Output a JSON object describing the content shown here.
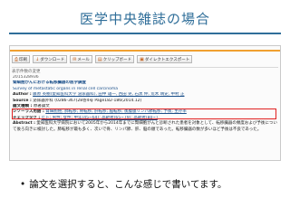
{
  "slide": {
    "title": "医学中央雑誌の場合",
    "bullet": "論文を選択すると、こんな感じで書いてます。"
  },
  "toolbar": {
    "buttons": [
      {
        "icon": "printer-icon",
        "glyph": "⎙",
        "label": "印刷"
      },
      {
        "icon": "download-icon",
        "glyph": "↓",
        "label": "ダウンロード"
      },
      {
        "icon": "mail-icon",
        "glyph": "✉",
        "label": "メール"
      },
      {
        "icon": "clipboard-icon",
        "glyph": "▤",
        "label": "クリップボード"
      },
      {
        "icon": "save-icon",
        "glyph": "▣",
        "label": "ダイレクトエクスポート"
      }
    ]
  },
  "result": {
    "label": "表示件数の変更"
  },
  "record": {
    "id": "2015328936",
    "title_ja": "腎細胞がんにおける転移臓器の医学調査",
    "title_en": "Survey of metastatic organs in renal cell carcinoma",
    "author_label": "Author :",
    "author": "藤原 英樹(愛知医科大学 泌尿器科), 田中 雄一, 西田 晃, 石黒 伸, 荒木 晴史, 中村 正",
    "source_label": "Source :",
    "source": "泌尿器外科 (0286-367)28巻4号 Page182-186(2014.12)",
    "doctype_label": "論文種類 :",
    "doctype": "原著論文",
    "thesaurus_label": "シソーラス用語 :",
    "thesaurus": "腎細胞癌; 肺転移; 骨転移; 肝転移; 脳転移; 後腹膜リンパ節転移; 予後; 生存率",
    "check_label": "チェックタグ :",
    "check": "ヒト; 男性; 女性; 中年(45~64); 高齢者(65~79); 高齢者(80~)",
    "abstract_label": "Abstract :",
    "abstract": "愛知医科大学病院において2005年から2014年までに腎細胞がんと診断された患者を対象として、転移臓器の頻度および予後について後ろ向きに検討した。肺転移が最も多く、次いで骨、リンパ節、肝、脳の順であった。転移臓器の数が多いほど予後は不良であった。"
  }
}
